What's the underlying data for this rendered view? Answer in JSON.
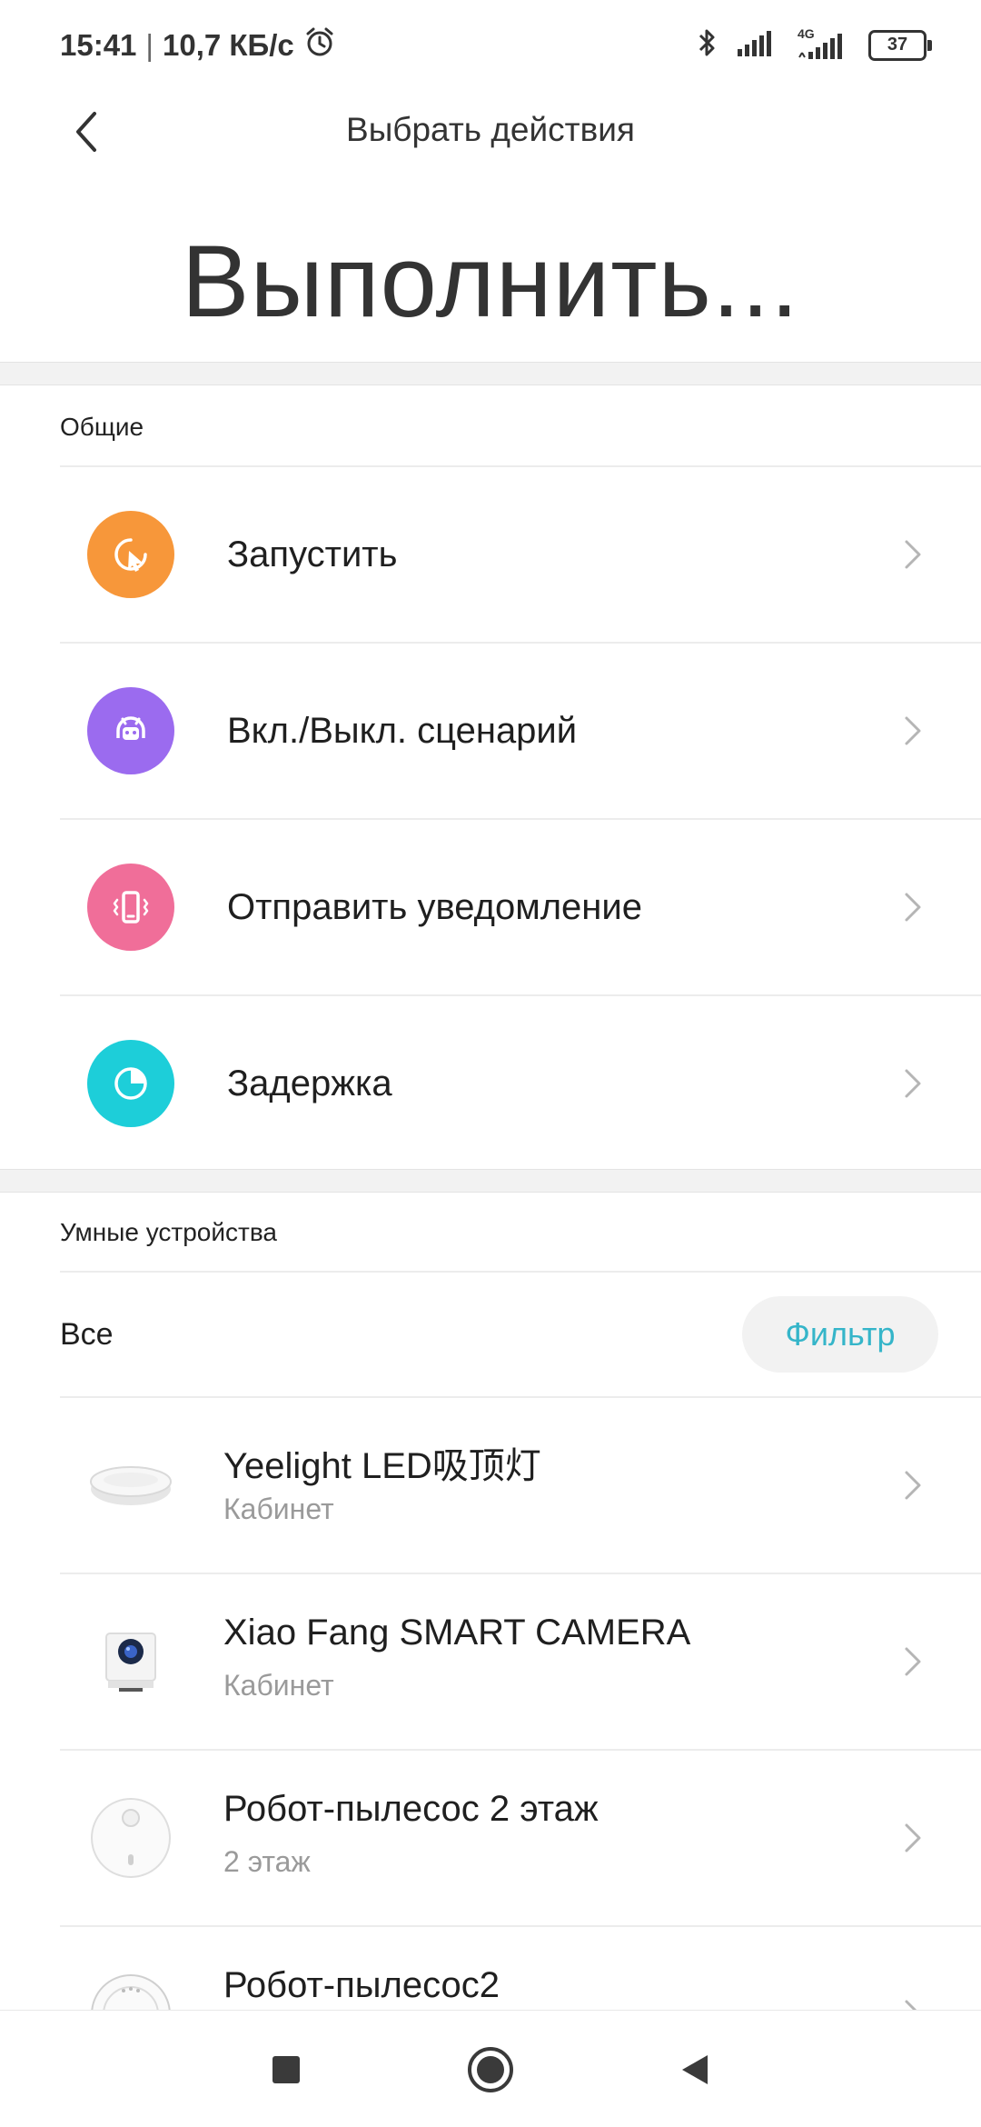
{
  "status_bar": {
    "time": "15:41",
    "separator": "|",
    "net_speed": "10,7 КБ/с",
    "battery": "37",
    "net_type": "4G"
  },
  "header": {
    "title": "Выбрать действия"
  },
  "hero_title": "Выполнить...",
  "general": {
    "label": "Общие",
    "items": [
      {
        "label": "Запустить",
        "icon": "cursor-click-icon",
        "color": "#F7973A"
      },
      {
        "label": "Вкл./Выкл. сценарий",
        "icon": "robot-icon",
        "color": "#9B6BEF"
      },
      {
        "label": "Отправить уведомление",
        "icon": "phone-vibrate-icon",
        "color": "#F06E99"
      },
      {
        "label": "Задержка",
        "icon": "timer-icon",
        "color": "#1DCED9"
      }
    ]
  },
  "devices": {
    "label": "Умные устройства",
    "all_label": "Все",
    "filter_label": "Фильтр",
    "items": [
      {
        "name": "Yeelight LED吸顶灯",
        "room": "Кабинет",
        "icon": "ceiling-light-icon"
      },
      {
        "name": "Xiao Fang SMART CAMERA",
        "room": "Кабинет",
        "icon": "camera-icon"
      },
      {
        "name": "Робот-пылесос 2 этаж",
        "room": "2 этаж",
        "icon": "robot-vacuum-icon"
      },
      {
        "name": "Робот-пылесос2",
        "room": "",
        "icon": "robot-vacuum-icon"
      }
    ]
  },
  "colors": {
    "accent": "#35B5C9",
    "muted": "#9A9A9A"
  }
}
